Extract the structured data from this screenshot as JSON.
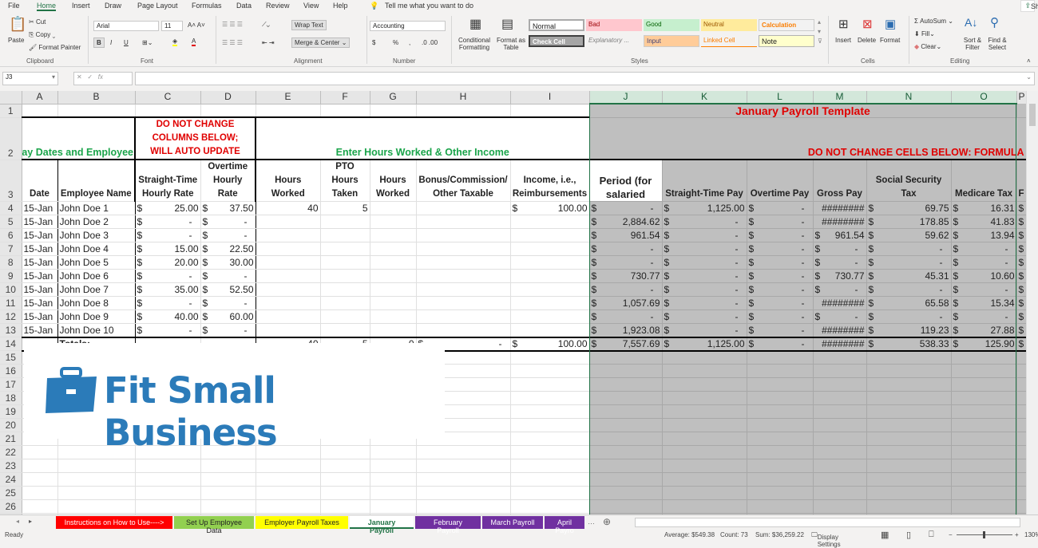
{
  "menu": {
    "tabs": [
      "File",
      "Home",
      "Insert",
      "Draw",
      "Page Layout",
      "Formulas",
      "Data",
      "Review",
      "View",
      "Help"
    ],
    "tell_me": "Tell me what you want to do",
    "share": "Share"
  },
  "ribbon": {
    "clipboard": {
      "paste": "Paste",
      "cut": "Cut",
      "copy": "Copy",
      "format_painter": "Format Painter",
      "label": "Clipboard"
    },
    "font": {
      "name": "Arial",
      "size": "11",
      "bold": "B",
      "italic": "I",
      "underline": "U",
      "label": "Font"
    },
    "alignment": {
      "wrap": "Wrap Text",
      "merge": "Merge & Center",
      "label": "Alignment"
    },
    "number": {
      "format": "Accounting",
      "currency": "$",
      "percent": "%",
      "comma": ",",
      "label": "Number"
    },
    "styles": {
      "conditional": "Conditional Formatting",
      "format_table": "Format as Table",
      "cells": [
        "Normal",
        "Bad",
        "Good",
        "Neutral",
        "Calculation",
        "Check Cell",
        "Explanatory ...",
        "Input",
        "Linked Cell",
        "Note"
      ],
      "label": "Styles"
    },
    "cells": {
      "insert": "Insert",
      "delete": "Delete",
      "format": "Format",
      "label": "Cells"
    },
    "editing": {
      "autosum": "AutoSum",
      "fill": "Fill",
      "clear": "Clear",
      "sort": "Sort & Filter",
      "find": "Find & Select",
      "label": "Editing"
    }
  },
  "formula_bar": {
    "name_box": "J3",
    "fx": "fx",
    "value": ""
  },
  "columns": [
    "A",
    "B",
    "C",
    "D",
    "E",
    "F",
    "G",
    "H",
    "I",
    "J",
    "K",
    "L",
    "M",
    "N",
    "O",
    "P"
  ],
  "sheet": {
    "row1_title": "January Payroll Template",
    "row2": {
      "pay_dates": "Pay Dates and Employee",
      "do_not_change": "DO NOT CHANGE COLUMNS BELOW; WILL AUTO UPDATE",
      "enter_hours": "Enter Hours Worked & Other Income",
      "formula_warning": "DO NOT CHANGE CELLS BELOW: FORMULA"
    },
    "headers": [
      "Date",
      "Employee Name",
      "Straight-Time Hourly Rate",
      "Overtime Hourly Rate",
      "Hours Worked",
      "PTO Hours Taken",
      "Hours Worked",
      "Bonus/Commission/ Other Taxable",
      "Income, i.e., Reimbursements",
      "Period (for salaried",
      "Straight-Time Pay",
      "Overtime Pay",
      "Gross Pay",
      "Social Security Tax",
      "Medicare Tax",
      "F"
    ],
    "rows": [
      [
        "15-Jan",
        "John Doe 1",
        "$ 25.00",
        "$ 37.50",
        "40",
        "5",
        "",
        "",
        "$ 100.00",
        "$ -",
        "$ 1,125.00",
        "$ -",
        "########",
        "$ 69.75",
        "$ 16.31",
        "$"
      ],
      [
        "15-Jan",
        "John Doe 2",
        "$ -",
        "$ -",
        "",
        "",
        "",
        "",
        "",
        "$ 2,884.62",
        "$ -",
        "$ -",
        "########",
        "$ 178.85",
        "$ 41.83",
        "$"
      ],
      [
        "15-Jan",
        "John Doe 3",
        "$ -",
        "$ -",
        "",
        "",
        "",
        "",
        "",
        "$ 961.54",
        "$ -",
        "$ -",
        "$ 961.54",
        "$ 59.62",
        "$ 13.94",
        "$"
      ],
      [
        "15-Jan",
        "John Doe 4",
        "$ 15.00",
        "$ 22.50",
        "",
        "",
        "",
        "",
        "",
        "$ -",
        "$ -",
        "$ -",
        "$ -",
        "$ -",
        "$ -",
        "$"
      ],
      [
        "15-Jan",
        "John Doe 5",
        "$ 20.00",
        "$ 30.00",
        "",
        "",
        "",
        "",
        "",
        "$ -",
        "$ -",
        "$ -",
        "$ -",
        "$ -",
        "$ -",
        "$"
      ],
      [
        "15-Jan",
        "John Doe 6",
        "$ -",
        "$ -",
        "",
        "",
        "",
        "",
        "",
        "$ 730.77",
        "$ -",
        "$ -",
        "$ 730.77",
        "$ 45.31",
        "$ 10.60",
        "$"
      ],
      [
        "15-Jan",
        "John Doe 7",
        "$ 35.00",
        "$ 52.50",
        "",
        "",
        "",
        "",
        "",
        "$ -",
        "$ -",
        "$ -",
        "$ -",
        "$ -",
        "$ -",
        "$"
      ],
      [
        "15-Jan",
        "John Doe 8",
        "$ -",
        "$ -",
        "",
        "",
        "",
        "",
        "",
        "$ 1,057.69",
        "$ -",
        "$ -",
        "########",
        "$ 65.58",
        "$ 15.34",
        "$"
      ],
      [
        "15-Jan",
        "John Doe 9",
        "$ 40.00",
        "$ 60.00",
        "",
        "",
        "",
        "",
        "",
        "$ -",
        "$ -",
        "$ -",
        "$ -",
        "$ -",
        "$ -",
        "$"
      ],
      [
        "15-Jan",
        "John Doe 10",
        "$ -",
        "$ -",
        "",
        "",
        "",
        "",
        "",
        "$ 1,923.08",
        "$ -",
        "$ -",
        "########",
        "$ 119.23",
        "$ 27.88",
        "$"
      ],
      [
        "",
        "Totals:",
        "",
        "",
        "40",
        "5",
        "0",
        "$ -",
        "$ 100.00",
        "$ 7,557.69",
        "$ 1,125.00",
        "$ -",
        "########",
        "$ 538.33",
        "$ 125.90",
        "$"
      ]
    ]
  },
  "logo": {
    "text": "Fit Small Business",
    "color": "#2b7bb9"
  },
  "sheet_tabs": [
    {
      "label": "Instructions on How to Use---->",
      "bg": "#ff0000",
      "fg": "#ffffff"
    },
    {
      "label": "Set Up Employee Data",
      "bg": "#92d050",
      "fg": "#222222"
    },
    {
      "label": "Employer Payroll Taxes",
      "bg": "#ffff00",
      "fg": "#222222"
    },
    {
      "label": "January Payroll",
      "bg": "#ffffff",
      "fg": "#217346",
      "active": true
    },
    {
      "label": "February Payroll",
      "bg": "#7030a0",
      "fg": "#ffffff"
    },
    {
      "label": "March Payroll",
      "bg": "#7030a0",
      "fg": "#ffffff"
    },
    {
      "label": "April Payro",
      "bg": "#7030a0",
      "fg": "#ffffff"
    }
  ],
  "status": {
    "ready": "Ready",
    "average": "Average: $549.38",
    "count": "Count: 73",
    "sum": "Sum: $36,259.22",
    "display": "Display Settings",
    "zoom": "130%"
  }
}
